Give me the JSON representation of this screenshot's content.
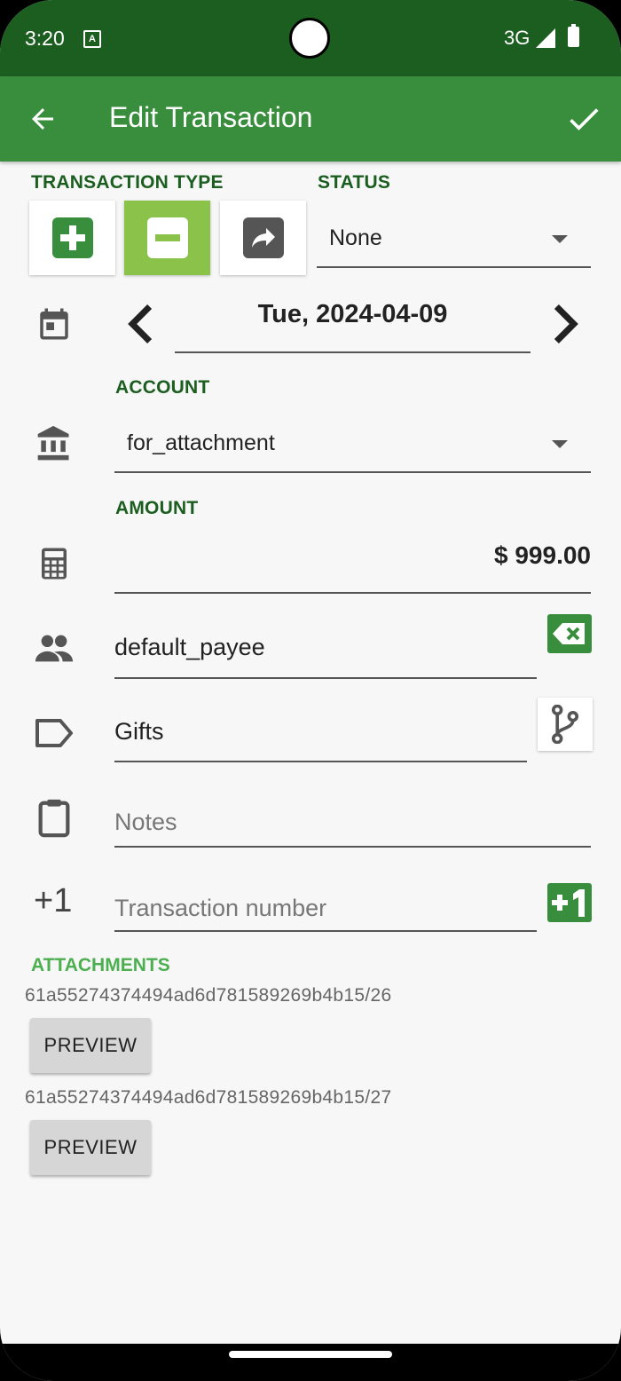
{
  "status_bar": {
    "time": "3:20",
    "network": "3G"
  },
  "app_bar": {
    "title": "Edit Transaction"
  },
  "transaction_type": {
    "label": "TRANSACTION TYPE",
    "selected": "minus"
  },
  "status": {
    "label": "STATUS",
    "value": "None"
  },
  "date": {
    "value": "Tue, 2024-04-09"
  },
  "account": {
    "label": "ACCOUNT",
    "value": "for_attachment"
  },
  "amount": {
    "label": "AMOUNT",
    "value": "$ 999.00"
  },
  "payee": {
    "value": "default_payee"
  },
  "category": {
    "value": "Gifts"
  },
  "notes": {
    "placeholder": "Notes"
  },
  "transaction_number": {
    "prefix": "+1",
    "placeholder": "Transaction number"
  },
  "attachments": {
    "label": "ATTACHMENTS",
    "items": [
      {
        "name": "61a55274374494ad6d781589269b4b15/26",
        "button": "PREVIEW"
      },
      {
        "name": "61a55274374494ad6d781589269b4b15/27",
        "button": "PREVIEW"
      }
    ]
  },
  "colors": {
    "primary_dark": "#1b5e20",
    "primary": "#388e3c",
    "selected": "#8bc34a",
    "accent": "#4caf50"
  }
}
